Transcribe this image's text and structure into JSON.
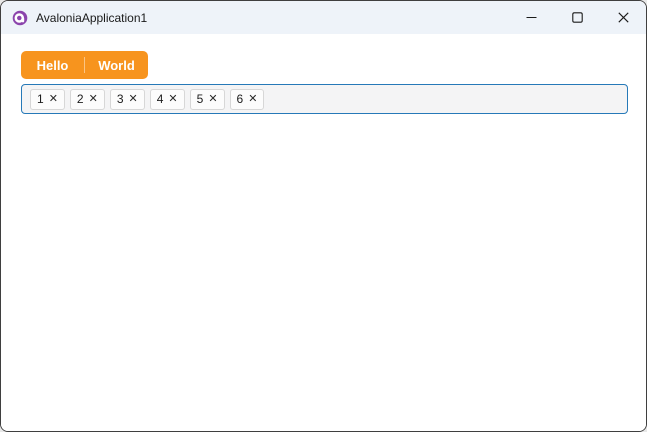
{
  "window": {
    "title": "AvaloniaApplication1",
    "titlebar_bg": "#eef3f9",
    "border_color": "#3f3f3f",
    "content_bg": "#ffffff",
    "icons": {
      "app_logo": "avalonia-logo",
      "minimize": "minimize",
      "maximize": "maximize",
      "close": "close"
    }
  },
  "tabstrip": {
    "accent_color": "#F7941E",
    "text_color": "#ffffff",
    "tabs": [
      {
        "label": "Hello"
      },
      {
        "label": "World"
      }
    ]
  },
  "chipbox": {
    "border_color": "#2679b8",
    "background": "#f4f4f5",
    "close_glyph": "✕",
    "chips": [
      {
        "label": "1"
      },
      {
        "label": "2"
      },
      {
        "label": "3"
      },
      {
        "label": "4"
      },
      {
        "label": "5"
      },
      {
        "label": "6"
      }
    ]
  }
}
